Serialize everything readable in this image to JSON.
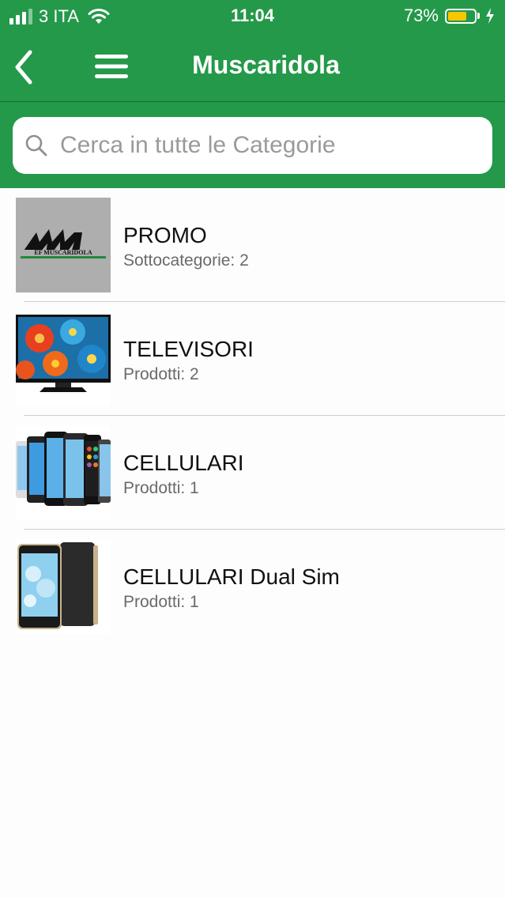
{
  "status_bar": {
    "carrier": "3 ITA",
    "time": "11:04",
    "battery_percent": "73%",
    "battery_level": 0.73,
    "signal_bars": 3,
    "signal_bars_total": 4,
    "wifi": true,
    "charging": true
  },
  "nav": {
    "title": "Muscaridola",
    "back_icon": "chevron-left-icon",
    "menu_icon": "hamburger-menu-icon"
  },
  "search": {
    "placeholder": "Cerca in tutte le Categorie",
    "value": "",
    "icon": "search-icon"
  },
  "categories": [
    {
      "title": "PROMO",
      "subtitle": "Sottocategorie: 2",
      "image": "promo-logo",
      "logo_text": "EF MUSCARIDOLA"
    },
    {
      "title": "TELEVISORI",
      "subtitle": "Prodotti: 2",
      "image": "television"
    },
    {
      "title": "CELLULARI",
      "subtitle": "Prodotti: 1",
      "image": "smartphones"
    },
    {
      "title": "CELLULARI Dual Sim",
      "subtitle": "Prodotti: 1",
      "image": "dual-sim-phone"
    }
  ],
  "colors": {
    "brand_green": "#24994a",
    "battery_yellow": "#f7c600"
  }
}
